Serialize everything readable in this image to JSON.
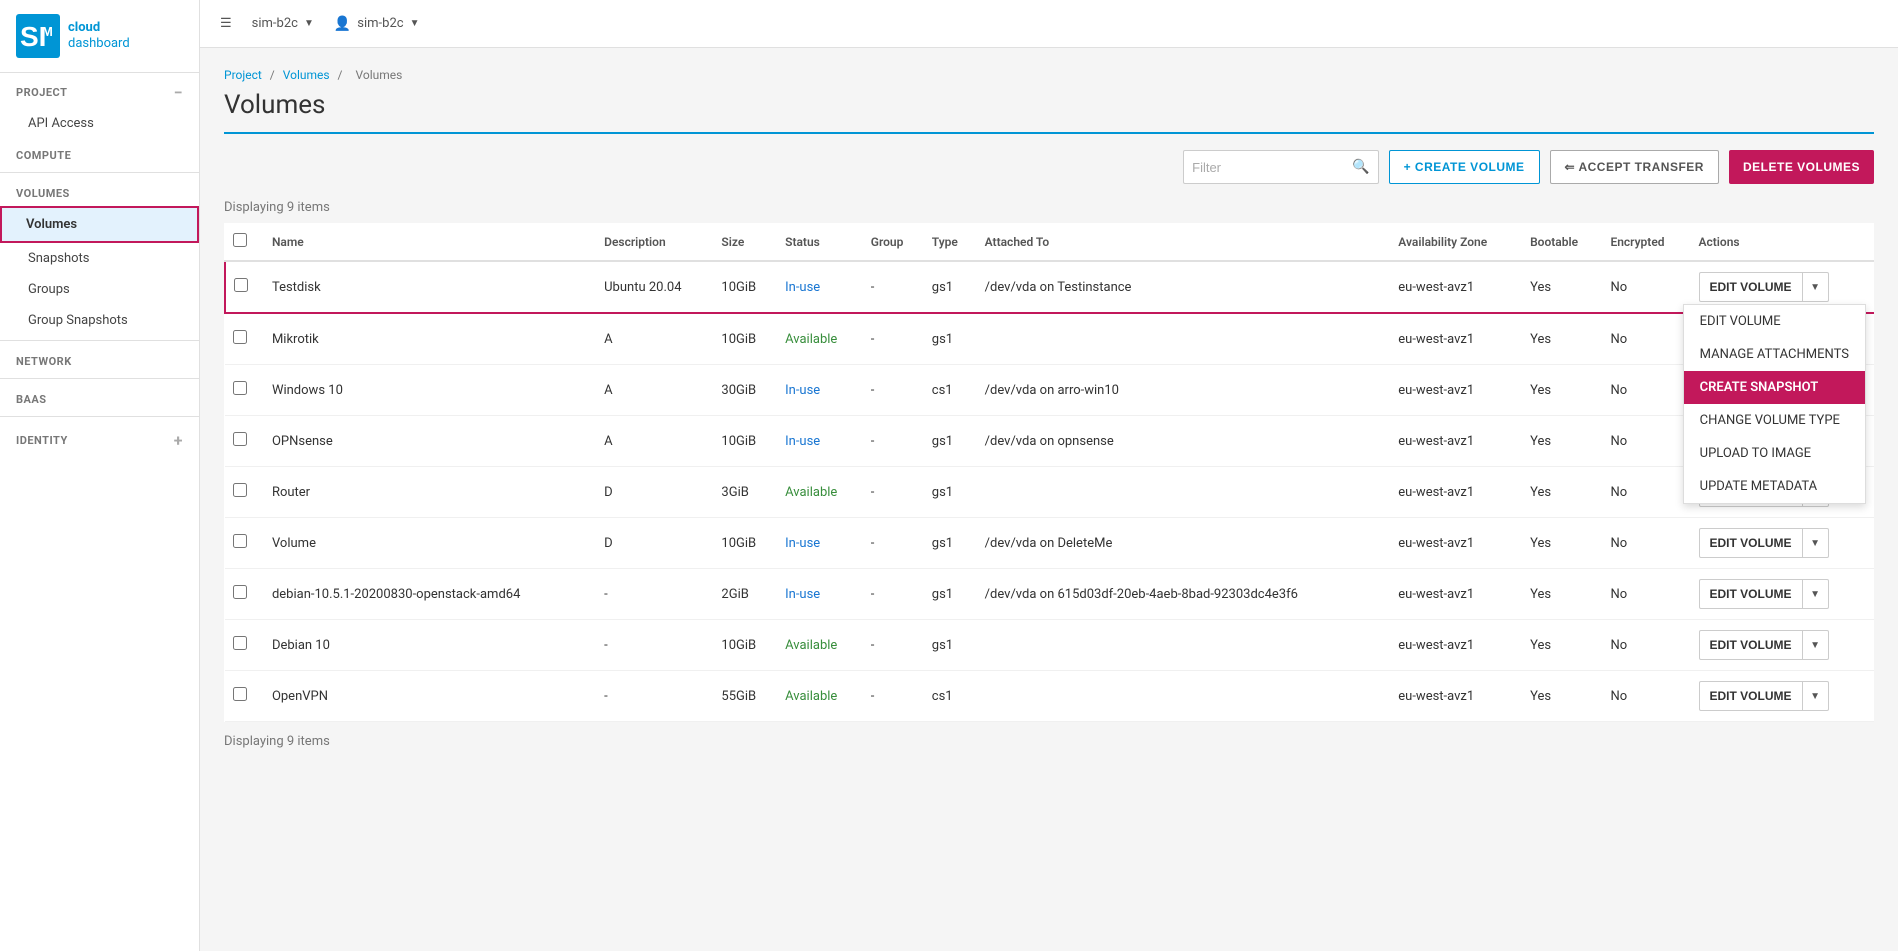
{
  "topbar": {
    "project_selector": "sim-b2c",
    "user_selector": "sim-b2c"
  },
  "sidebar": {
    "logo_cloud": "cloud",
    "logo_dashboard": "dashboard",
    "project_label": "PROJECT",
    "api_access_label": "API Access",
    "compute_label": "COMPUTE",
    "volumes_label": "VOLUMES",
    "volumes_item": "Volumes",
    "snapshots_item": "Snapshots",
    "groups_item": "Groups",
    "group_snapshots_item": "Group Snapshots",
    "network_label": "NETWORK",
    "baas_label": "BAAS",
    "identity_label": "IDENTITY"
  },
  "breadcrumb": {
    "project": "Project",
    "volumes": "Volumes",
    "current": "Volumes"
  },
  "page": {
    "title": "Volumes",
    "displaying_top": "Displaying 9 items",
    "displaying_bottom": "Displaying 9 items"
  },
  "toolbar": {
    "filter_placeholder": "Filter",
    "create_volume_label": "+ CREATE VOLUME",
    "accept_transfer_label": "⇐ ACCEPT TRANSFER",
    "delete_volumes_label": "DELETE VOLUMES"
  },
  "table": {
    "headers": [
      "",
      "Name",
      "Description",
      "Size",
      "Status",
      "Group",
      "Type",
      "Attached To",
      "Availability Zone",
      "Bootable",
      "Encrypted",
      "Actions"
    ],
    "rows": [
      {
        "name": "Testdisk",
        "description": "Ubuntu 20.04",
        "size": "10GiB",
        "status": "In-use",
        "group": "-",
        "type": "gs1",
        "attached_to": "/dev/vda on Testinstance",
        "az": "eu-west-avz1",
        "bootable": "Yes",
        "encrypted": "No",
        "highlighted": true
      },
      {
        "name": "Mikrotik",
        "description": "A",
        "size": "10GiB",
        "status": "Available",
        "group": "-",
        "type": "gs1",
        "attached_to": "",
        "az": "eu-west-avz1",
        "bootable": "Yes",
        "encrypted": "No",
        "highlighted": false
      },
      {
        "name": "Windows 10",
        "description": "A",
        "size": "30GiB",
        "status": "In-use",
        "group": "-",
        "type": "cs1",
        "attached_to": "/dev/vda on arro-win10",
        "az": "eu-west-avz1",
        "bootable": "Yes",
        "encrypted": "No",
        "highlighted": false
      },
      {
        "name": "OPNsense",
        "description": "A",
        "size": "10GiB",
        "status": "In-use",
        "group": "-",
        "type": "gs1",
        "attached_to": "/dev/vda on opnsense",
        "az": "eu-west-avz1",
        "bootable": "Yes",
        "encrypted": "No",
        "highlighted": false
      },
      {
        "name": "Router",
        "description": "D",
        "size": "3GiB",
        "status": "Available",
        "group": "-",
        "type": "gs1",
        "attached_to": "",
        "az": "eu-west-avz1",
        "bootable": "Yes",
        "encrypted": "No",
        "highlighted": false
      },
      {
        "name": "Volume",
        "description": "D",
        "size": "10GiB",
        "status": "In-use",
        "group": "-",
        "type": "gs1",
        "attached_to": "/dev/vda on DeleteMe",
        "az": "eu-west-avz1",
        "bootable": "Yes",
        "encrypted": "No",
        "highlighted": false
      },
      {
        "name": "debian-10.5.1-20200830-openstack-amd64",
        "description": "-",
        "size": "2GiB",
        "status": "In-use",
        "group": "-",
        "type": "gs1",
        "attached_to": "/dev/vda on 615d03df-20eb-4aeb-8bad-92303dc4e3f6",
        "az": "eu-west-avz1",
        "bootable": "Yes",
        "encrypted": "No",
        "highlighted": false
      },
      {
        "name": "Debian 10",
        "description": "-",
        "size": "10GiB",
        "status": "Available",
        "group": "-",
        "type": "gs1",
        "attached_to": "",
        "az": "eu-west-avz1",
        "bootable": "Yes",
        "encrypted": "No",
        "highlighted": false
      },
      {
        "name": "OpenVPN",
        "description": "-",
        "size": "55GiB",
        "status": "Available",
        "group": "-",
        "type": "cs1",
        "attached_to": "",
        "az": "eu-west-avz1",
        "bootable": "Yes",
        "encrypted": "No",
        "highlighted": false
      }
    ]
  },
  "dropdown": {
    "items": [
      {
        "label": "EDIT VOLUME",
        "highlighted": false
      },
      {
        "label": "MANAGE ATTACHMENTS",
        "highlighted": false
      },
      {
        "label": "CREATE SNAPSHOT",
        "highlighted": true
      },
      {
        "label": "CHANGE VOLUME TYPE",
        "highlighted": false
      },
      {
        "label": "UPLOAD TO IMAGE",
        "highlighted": false
      },
      {
        "label": "UPDATE METADATA",
        "highlighted": false
      }
    ]
  }
}
